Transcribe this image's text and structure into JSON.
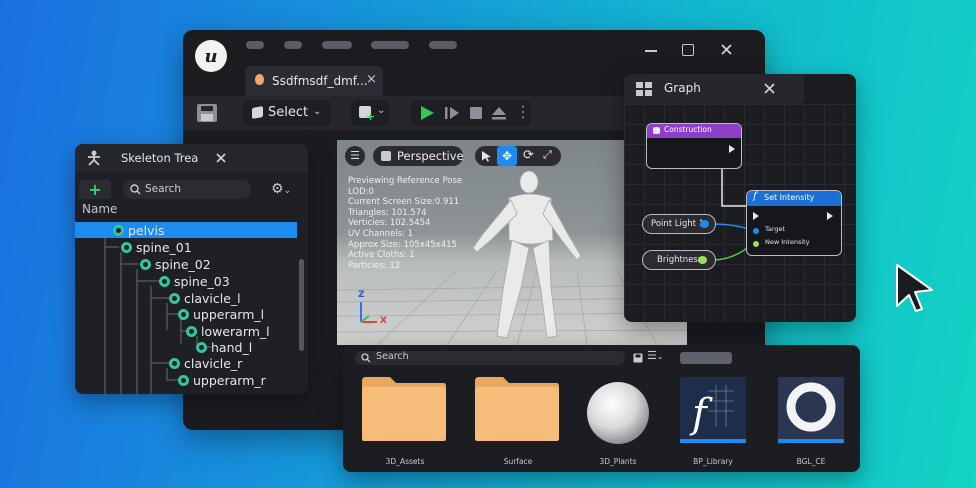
{
  "editor": {
    "tab_title": "Ssdfmsdf_dmf...",
    "tab_close": "×",
    "select_label": "Select",
    "logo_letter": "u"
  },
  "skeleton_panel": {
    "title": "Skeleton Trea",
    "close": "×",
    "add": "+",
    "search_placeholder": "Search",
    "column_header": "Name",
    "bones": [
      {
        "name": "pelvis",
        "selected": true
      },
      {
        "name": "spine_01"
      },
      {
        "name": "spine_02"
      },
      {
        "name": "spine_03"
      },
      {
        "name": "clavicle_l"
      },
      {
        "name": "upperarm_l"
      },
      {
        "name": "lowerarm_l"
      },
      {
        "name": "hand_l"
      },
      {
        "name": "clavicle_r"
      },
      {
        "name": "upperarm_r"
      }
    ]
  },
  "viewport": {
    "view_mode": "Perspective",
    "stats": [
      "Previewing Reference Pose",
      "LOD:0",
      "Current Screen Size:0.911",
      "Triangles: 101.574",
      "Verticies: 102.5454",
      "UV Channels: 1",
      "Approx Size: 105x45x415",
      "Active Cloths: 1",
      "Particies: 12"
    ],
    "axis_z": "Z",
    "axis_x": "X"
  },
  "graph_panel": {
    "title": "Graph",
    "close": "×",
    "construction_node": "Construction",
    "set_intensity_node": "Set Intensity",
    "function_glyph": "f",
    "target_pin": "Target",
    "new_intensity_pin": "New Intensity",
    "point_light": "Point Light 1",
    "brightness": "Brightness"
  },
  "content_browser": {
    "search_placeholder": "Search",
    "assets": [
      {
        "label": "3D_Assets",
        "kind": "folder"
      },
      {
        "label": "Surface",
        "kind": "folder"
      },
      {
        "label": "3D_Plants",
        "kind": "sphere"
      },
      {
        "label": "BP_Library",
        "kind": "blueprint"
      },
      {
        "label": "BGL_CE",
        "kind": "ring"
      }
    ]
  },
  "colors": {
    "accent_blue": "#1c8cf0",
    "bone_green": "#35c3a0",
    "play_green": "#34c759",
    "folder": "#f2b870",
    "construction_purple": "#8d3fc9"
  }
}
